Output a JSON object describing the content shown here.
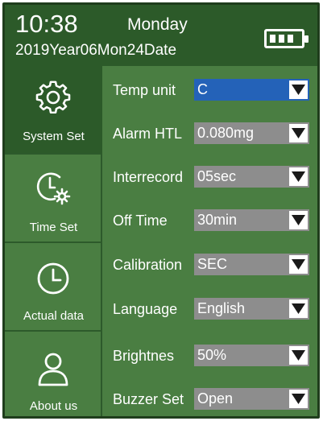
{
  "header": {
    "time": "10:38",
    "weekday": "Monday",
    "date": "2019Year06Mon24Date",
    "battery_level": 1.0
  },
  "sidebar": {
    "items": [
      {
        "label": "System Set",
        "icon": "gear-icon",
        "active": true
      },
      {
        "label": "Time Set",
        "icon": "clock-gear-icon",
        "active": false
      },
      {
        "label": "Actual data",
        "icon": "clock-icon",
        "active": false
      },
      {
        "label": "About us",
        "icon": "user-icon",
        "active": false
      }
    ]
  },
  "settings": [
    {
      "label": "Temp unit",
      "value": "C"
    },
    {
      "label": "Alarm HTL",
      "value": "0.080mg"
    },
    {
      "label": "Interrecord",
      "value": "05sec"
    },
    {
      "label": "Off Time",
      "value": "30min"
    },
    {
      "label": "Calibration",
      "value": "SEC"
    },
    {
      "label": "Language",
      "value": "English"
    },
    {
      "label": "Brightnes",
      "value": "50%"
    },
    {
      "label": "Buzzer Set",
      "value": "Open"
    }
  ],
  "colors": {
    "background": "#4a7e42",
    "header": "#2c5a29",
    "select_highlight": "#2462b8",
    "select_normal": "#8d8d8d"
  }
}
